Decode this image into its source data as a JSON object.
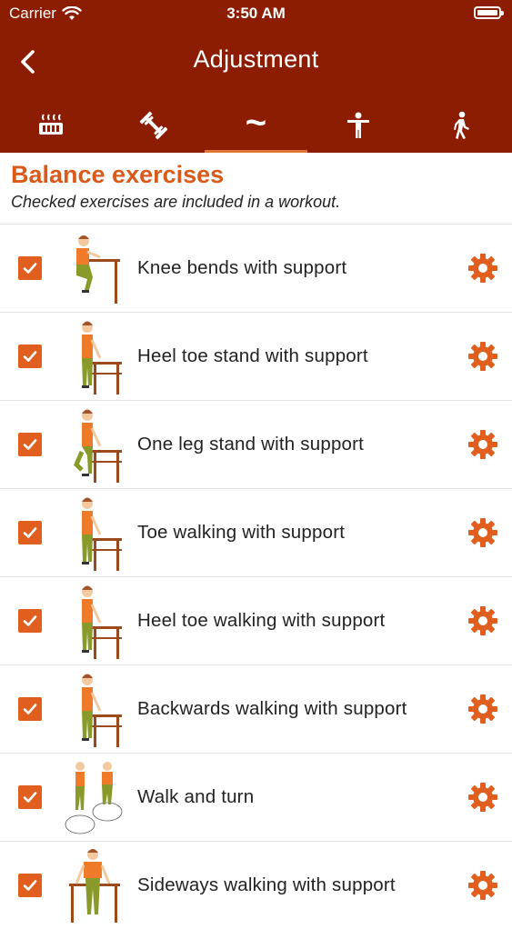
{
  "status": {
    "carrier": "Carrier",
    "time": "3:50 AM",
    "battery_level": 1.0
  },
  "nav": {
    "title": "Adjustment",
    "back_icon": "chevron-left-icon"
  },
  "tabs": [
    {
      "icon": "heating-icon",
      "active": false
    },
    {
      "icon": "dumbbell-icon",
      "active": false
    },
    {
      "icon": "tilde-balance-icon",
      "label": "~",
      "active": true
    },
    {
      "icon": "stretch-person-icon",
      "active": false
    },
    {
      "icon": "walking-person-icon",
      "active": false
    }
  ],
  "section": {
    "title": "Balance exercises",
    "subtitle": "Checked exercises are included in a workout."
  },
  "colors": {
    "header": "#8c1c02",
    "accent": "#e05e1e",
    "title": "#d95a1a"
  },
  "exercises": [
    {
      "label": "Knee bends with support",
      "checked": true,
      "pose": "bend"
    },
    {
      "label": "Heel toe stand with support",
      "checked": true,
      "pose": "stand"
    },
    {
      "label": "One leg stand with support",
      "checked": true,
      "pose": "oneleg"
    },
    {
      "label": "Toe walking with support",
      "checked": true,
      "pose": "stand"
    },
    {
      "label": "Heel toe walking with support",
      "checked": true,
      "pose": "stand"
    },
    {
      "label": "Backwards walking with support",
      "checked": true,
      "pose": "stand"
    },
    {
      "label": "Walk and turn",
      "checked": true,
      "pose": "turn"
    },
    {
      "label": "Sideways walking with support",
      "checked": true,
      "pose": "side"
    }
  ]
}
